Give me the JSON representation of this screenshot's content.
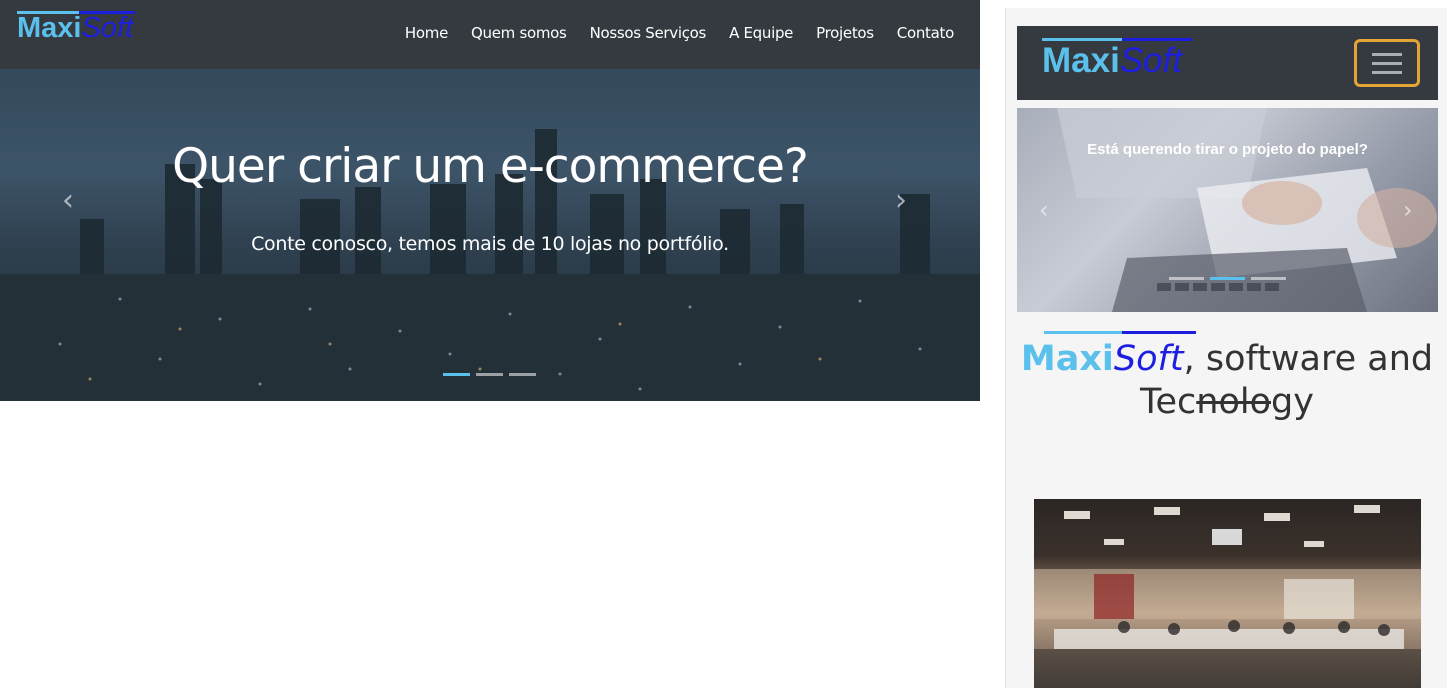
{
  "desktop": {
    "logo": {
      "part1": "Maxi",
      "part2": "Soft"
    },
    "nav": [
      "Home",
      "Quem somos",
      "Nossos Serviços",
      "A Equipe",
      "Projetos",
      "Contato"
    ],
    "hero": {
      "title": "Quer criar um e-commerce?",
      "subtitle": "Conte conosco, temos mais de 10 lojas no portfólio.",
      "prev_icon": "‹",
      "next_icon": "›",
      "slides": 3,
      "active_slide": 1
    }
  },
  "mobile": {
    "logo": {
      "part1": "Maxi",
      "part2": "Soft"
    },
    "menu_icon": "hamburger-menu-icon",
    "hero": {
      "title": "Está querendo tirar o projeto do papel?",
      "prev_icon": "‹",
      "next_icon": "›",
      "slides": 3,
      "active_slide": 2
    },
    "tagline": {
      "maxi": "Maxi",
      "soft": "Soft",
      "rest1": ", software and",
      "rest2a": "Tec",
      "rest2b": "nolo",
      "rest2c": "gy"
    }
  },
  "colors": {
    "navbar": "#343a40",
    "logo_cyan": "#5bc0eb",
    "logo_blue": "#1d1ee0",
    "toggler_border": "#e3a535"
  }
}
